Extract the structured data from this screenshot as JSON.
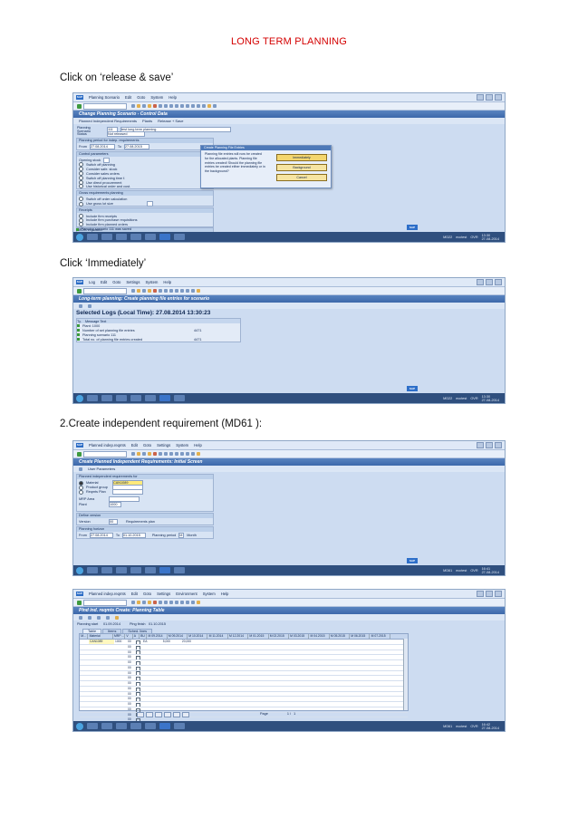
{
  "doc": {
    "title": "LONG TERM PLANNING",
    "captions": [
      "Click on ‘release & save’",
      "Click ‘Immediately’",
      "2.Create independent requirement  (MD61 ):"
    ]
  },
  "screens": {
    "s1": {
      "menu": [
        "Planning Scenario",
        "Edit",
        "Goto",
        "System",
        "Help"
      ],
      "title": "Change Planning Scenario - Control Data",
      "app_toolbar": [
        "Planned Independent Requirements",
        "Plants",
        "Release + Save"
      ],
      "fields": {
        "scenario_label": "Planning Scenario",
        "scenario_value": "111",
        "scenario_desc": "test long term planning",
        "status_label": "Status",
        "status_value": "Not released"
      },
      "period_group": "Planning period for indep. requirements",
      "from_label": "From",
      "from_value": "27.08.2014",
      "to_label": "To",
      "to_value": "27.08.2015",
      "control_group": "Control parameters",
      "opening_stock": "Opening stock",
      "control_options": [
        "Switch off planning",
        "Consider safe. stock",
        "Consider sales orders",
        "Switch off planning time f.",
        "Use direct procurement",
        "Use historical order and cust."
      ],
      "bom_group": "Gross requirements planning",
      "bom_options": [
        "Switch off order calculation",
        "Use gross lot size"
      ],
      "receipts_group": "Receipts",
      "receipts_options": [
        "Include firm receipts",
        "Include firm purchase requisitions",
        "Include firm planned orders"
      ],
      "bom_explosion": "BOM explosion",
      "status_msg": "Planning scenario 111 was saved",
      "dialog": {
        "title": "Create Planning File Entries",
        "text": "Planning file entries will now be created for the allocated plants. Planning file entries created! Should the planning file entries be created either immediately or in the background?",
        "btn_immediately": "Immediately",
        "btn_background": "Background",
        "btn_cancel": "Cancel"
      },
      "sys": "MD22",
      "server": "ecctest",
      "mode": "OVR",
      "time": "13:30",
      "date": "27-08-2014"
    },
    "s2": {
      "menu": [
        "Log",
        "Edit",
        "Goto",
        "Settings",
        "System",
        "Help"
      ],
      "title": "Long-term planning: Create planning file entries for scenario",
      "heading": "Selected Logs (Local Time): 27.08.2014 13:30:23",
      "col_ty": "Ty.",
      "col_msg": "Message Text",
      "rows": [
        {
          "text": "Plant: 1000",
          "value": ""
        },
        {
          "text": "Number of set planning file entries",
          "value": "4471"
        },
        {
          "text": "Planning scenario 111",
          "value": ""
        },
        {
          "text": "Total no. of planning file entries created",
          "value": "4471"
        }
      ],
      "sys": "MD22",
      "server": "ecctest",
      "mode": "OVR",
      "time": "13:30",
      "date": "27-08-2014"
    },
    "s3": {
      "menu": [
        "Planned indep.reqmts",
        "Edit",
        "Goto",
        "Settings",
        "System",
        "Help"
      ],
      "title": "Create Planned Independent Requirements: Initial Screen",
      "app_toolbar": [
        "User Parameters"
      ],
      "req_group": "Planned independent requirements for",
      "radio_material": "Material",
      "material_value": "CAN1089",
      "radio_product_group": "Product group",
      "radio_reqmts_plan": "Reqmts Plan",
      "mrp_area": "MRP Area",
      "plant_label": "Plant",
      "plant_value": "1000",
      "version_group": "Define version",
      "version_label": "Version",
      "version_value": "00",
      "version_desc": "Requirements plan",
      "horizon_group": "Planning horizon",
      "from_label": "From",
      "from_value": "27.08.2014",
      "to_label": "To",
      "to_value": "01.10.2015",
      "period_label": "Planning period",
      "period_value": "M",
      "period_desc": "Month",
      "sys": "MD61",
      "server": "ecctest",
      "mode": "OVR",
      "time": "16:41",
      "date": "27-08-2014"
    },
    "s4": {
      "menu": [
        "Planned indep.reqmts",
        "Edit",
        "Goto",
        "Settings",
        "Environment",
        "System",
        "Help"
      ],
      "title": "Plnd ind. reqmts Create: Planning Table",
      "start_label": "Planning start",
      "start_value": "01.09.2014",
      "finish_label": "Plng finish",
      "finish_value": "01.10.2015",
      "tabs": [
        "Table",
        "Items",
        "Sched. lines"
      ],
      "headers": [
        "M...",
        "Material",
        "MRP ...",
        "V",
        "A",
        "BU",
        "M 09.2014",
        "M 09.2014",
        "M 10.2014",
        "M 11.2014",
        "M 12.2014",
        "M 01.2015",
        "M 02.2015",
        "M 03.2015",
        "M 04.2015",
        "M 05.2015",
        "M 06.2015",
        "M 07.2015"
      ],
      "first_row": {
        "material": "CAN1089",
        "mrp": "1000",
        "v": "00",
        "bu": "EA",
        "m1": "5,000",
        "m2": "20,000"
      },
      "other_rows_v": "00",
      "page_label": "Page",
      "page_value": "1 /",
      "page_total": "1",
      "sys": "MD61",
      "server": "ecctest",
      "mode": "OVR",
      "time": "16:42",
      "date": "27-08-2014"
    }
  }
}
